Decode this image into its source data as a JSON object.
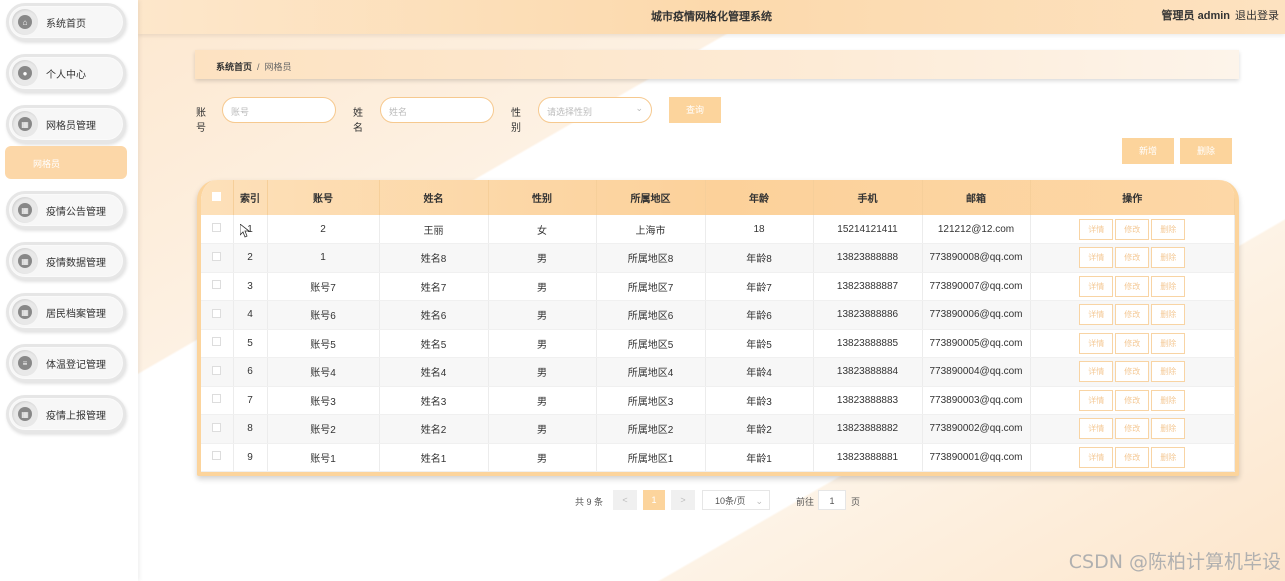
{
  "header": {
    "title": "城市疫情网格化管理系统",
    "user": "管理员 admin",
    "logout": "退出登录"
  },
  "sidebar": {
    "items": [
      {
        "label": "系统首页"
      },
      {
        "label": "个人中心"
      },
      {
        "label": "网格员管理"
      },
      {
        "label": "疫情公告管理"
      },
      {
        "label": "疫情数据管理"
      },
      {
        "label": "居民档案管理"
      },
      {
        "label": "体温登记管理"
      },
      {
        "label": "疫情上报管理"
      }
    ],
    "submenu": "网格员"
  },
  "breadcrumb": {
    "home": "系统首页",
    "sep": "/",
    "current": "网格员"
  },
  "search": {
    "account_label": "账号",
    "account_placeholder": "账号",
    "name_label": "姓名",
    "name_placeholder": "姓名",
    "gender_label": "性别",
    "gender_placeholder": "请选择性别",
    "query_button": "查询"
  },
  "actions": {
    "add": "新增",
    "delete": "删除"
  },
  "table": {
    "headers": [
      "索引",
      "账号",
      "姓名",
      "性别",
      "所属地区",
      "年龄",
      "手机",
      "邮箱",
      "操作"
    ],
    "op_labels": {
      "detail": "详情",
      "edit": "修改",
      "delete": "删除"
    },
    "rows": [
      [
        "1",
        "2",
        "王丽",
        "女",
        "上海市",
        "18",
        "15214121411",
        "121212@12.com"
      ],
      [
        "2",
        "1",
        "姓名8",
        "男",
        "所属地区8",
        "年龄8",
        "13823888888",
        "773890008@qq.com"
      ],
      [
        "3",
        "账号7",
        "姓名7",
        "男",
        "所属地区7",
        "年龄7",
        "13823888887",
        "773890007@qq.com"
      ],
      [
        "4",
        "账号6",
        "姓名6",
        "男",
        "所属地区6",
        "年龄6",
        "13823888886",
        "773890006@qq.com"
      ],
      [
        "5",
        "账号5",
        "姓名5",
        "男",
        "所属地区5",
        "年龄5",
        "13823888885",
        "773890005@qq.com"
      ],
      [
        "6",
        "账号4",
        "姓名4",
        "男",
        "所属地区4",
        "年龄4",
        "13823888884",
        "773890004@qq.com"
      ],
      [
        "7",
        "账号3",
        "姓名3",
        "男",
        "所属地区3",
        "年龄3",
        "13823888883",
        "773890003@qq.com"
      ],
      [
        "8",
        "账号2",
        "姓名2",
        "男",
        "所属地区2",
        "年龄2",
        "13823888882",
        "773890002@qq.com"
      ],
      [
        "9",
        "账号1",
        "姓名1",
        "男",
        "所属地区1",
        "年龄1",
        "13823888881",
        "773890001@qq.com"
      ]
    ]
  },
  "pagination": {
    "total": "共 9 条",
    "prev": "<",
    "page": "1",
    "next": ">",
    "page_size": "10条/页",
    "goto_label": "前往",
    "goto_value": "1",
    "page_suffix": "页"
  },
  "watermark": "CSDN @陈柏计算机毕设",
  "colors": {
    "accent": "#fcd49c",
    "border_accent": "#f6c98f"
  }
}
